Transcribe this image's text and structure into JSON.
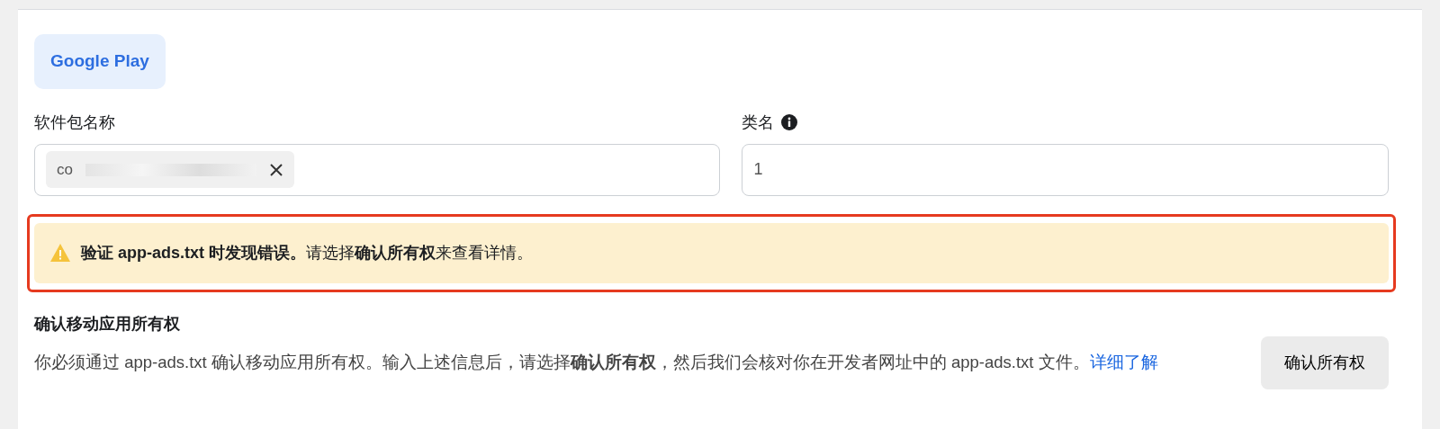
{
  "store_button": {
    "label": "Google Play",
    "selected": true
  },
  "fields": [
    {
      "label": "软件包名称",
      "kind": "chip",
      "chip_text": "co"
    },
    {
      "label": "类名",
      "kind": "text",
      "value": "1",
      "info": true
    }
  ],
  "alert": {
    "kind": "warning",
    "highlighted": true,
    "text": "**验证 app-ads.txt 时发现错误。**请选择**确认所有权**来查看详情。"
  },
  "ownership": {
    "title": "确认移动应用所有权",
    "description": "你必须通过 app-ads.txt 确认移动应用所有权。输入上述信息后，请选择**确认所有权**，然后我们会核对你在开发者网址中的 app-ads.txt 文件。",
    "link": "详细了解",
    "button": "确认所有权"
  }
}
